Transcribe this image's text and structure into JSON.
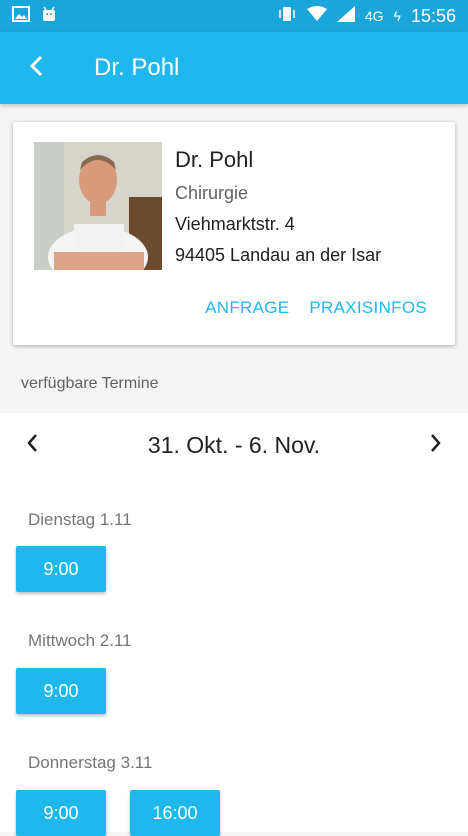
{
  "status_bar": {
    "network": "4G",
    "time": "15:56"
  },
  "app_bar": {
    "title": "Dr. Pohl"
  },
  "doctor": {
    "name": "Dr. Pohl",
    "specialty": "Chirurgie",
    "street": "Viehmarktstr. 4",
    "city": "94405 Landau an der Isar",
    "actions": {
      "request": "ANFRAGE",
      "practice_info": "PRAXISINFOS"
    }
  },
  "appointments": {
    "section_label": "verfügbare Termine",
    "week_range": "31. Okt. - 6. Nov.",
    "days": [
      {
        "label": "Dienstag 1.11",
        "slots": [
          "9:00"
        ]
      },
      {
        "label": "Mittwoch 2.11",
        "slots": [
          "9:00"
        ]
      },
      {
        "label": "Donnerstag 3.11",
        "slots": [
          "9:00",
          "16:00"
        ]
      }
    ]
  },
  "colors": {
    "primary": "#1fb8ec",
    "status_bar": "#1aa6d8"
  }
}
